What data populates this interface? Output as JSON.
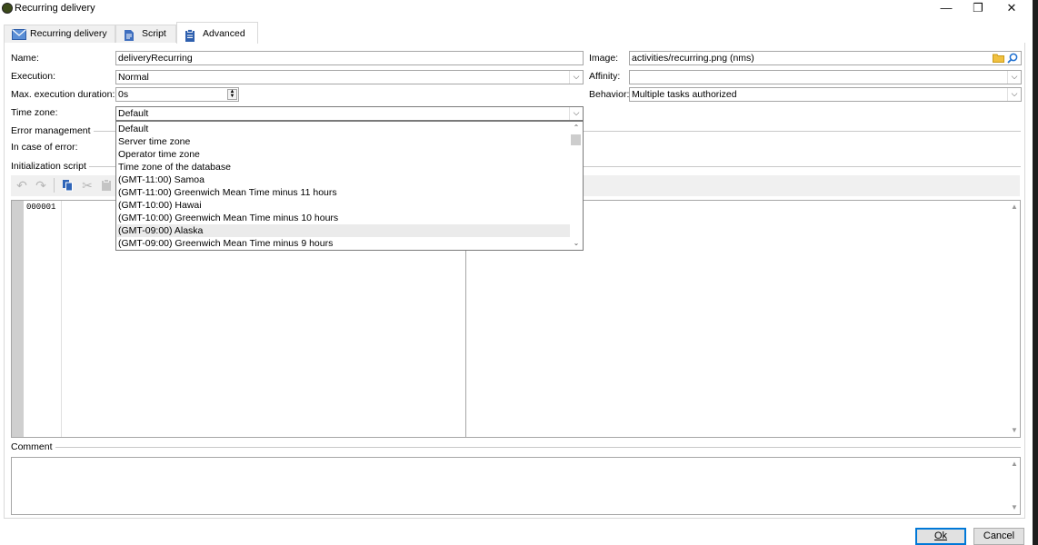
{
  "window": {
    "title": "Recurring delivery",
    "controls": [
      "—",
      "❐",
      "✕"
    ]
  },
  "tabs": [
    {
      "label": "Recurring delivery",
      "icon": "envelope-icon"
    },
    {
      "label": "Script",
      "icon": "script-icon"
    },
    {
      "label": "Advanced",
      "icon": "clipboard-icon",
      "active": true
    }
  ],
  "form": {
    "name_label": "Name:",
    "name_value": "deliveryRecurring",
    "execution_label": "Execution:",
    "execution_value": "Normal",
    "max_duration_label": "Max. execution duration:",
    "max_duration_value": "0s",
    "timezone_label": "Time zone:",
    "timezone_value": "Default",
    "image_label": "Image:",
    "image_value": "activities/recurring.png (nms)",
    "affinity_label": "Affinity:",
    "affinity_value": "",
    "behavior_label": "Behavior:",
    "behavior_value": "Multiple tasks authorized",
    "error_management_label": "Error management",
    "in_case_of_error_label": "In case of error:",
    "init_script_label": "Initialization script",
    "comment_label": "Comment"
  },
  "timezone_options": [
    "Default",
    "Server time zone",
    "Operator time zone",
    "Time zone of the database",
    "(GMT-11:00) Samoa",
    "(GMT-11:00) Greenwich Mean Time minus 11 hours",
    "(GMT-10:00) Hawai",
    "(GMT-10:00) Greenwich Mean Time minus 10 hours",
    "(GMT-09:00) Alaska",
    "(GMT-09:00) Greenwich Mean Time minus 9 hours"
  ],
  "timezone_highlighted_index": 8,
  "editor": {
    "line_number": "000001"
  },
  "buttons": {
    "ok": "Ok",
    "cancel": "Cancel"
  },
  "colors": {
    "default_button_border": "#0078d7",
    "folder_icon": "#f0c040",
    "search_icon": "#1e6fd0"
  }
}
